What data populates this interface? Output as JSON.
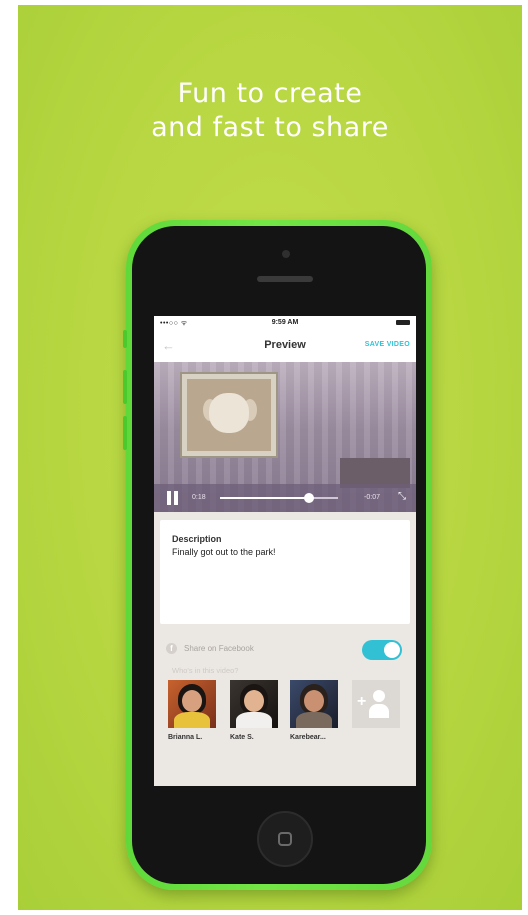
{
  "poster": {
    "headline_line1": "Fun to create",
    "headline_line2": "and fast to share",
    "background_color": "#b6d640",
    "phone_color": "#6ee043"
  },
  "status_bar": {
    "signal": "•••○○ ᯤ",
    "time": "9:59 AM"
  },
  "nav": {
    "back_icon": "←",
    "title": "Preview",
    "save_label": "SAVE VIDEO"
  },
  "player": {
    "current_time": "0:18",
    "remaining_time": "-0:07",
    "progress": 0.75,
    "fullscreen_icon": "⤡"
  },
  "description": {
    "label": "Description",
    "text": "Finally got out to the park!"
  },
  "share": {
    "facebook_label": "Share on Facebook",
    "facebook_enabled": true,
    "accent_color": "#32c0d4",
    "who_label": "Who's in this video?"
  },
  "people": [
    {
      "name": "Brianna L."
    },
    {
      "name": "Kate S."
    },
    {
      "name": "Karebear..."
    }
  ],
  "add_person_icon": "add-person-icon"
}
